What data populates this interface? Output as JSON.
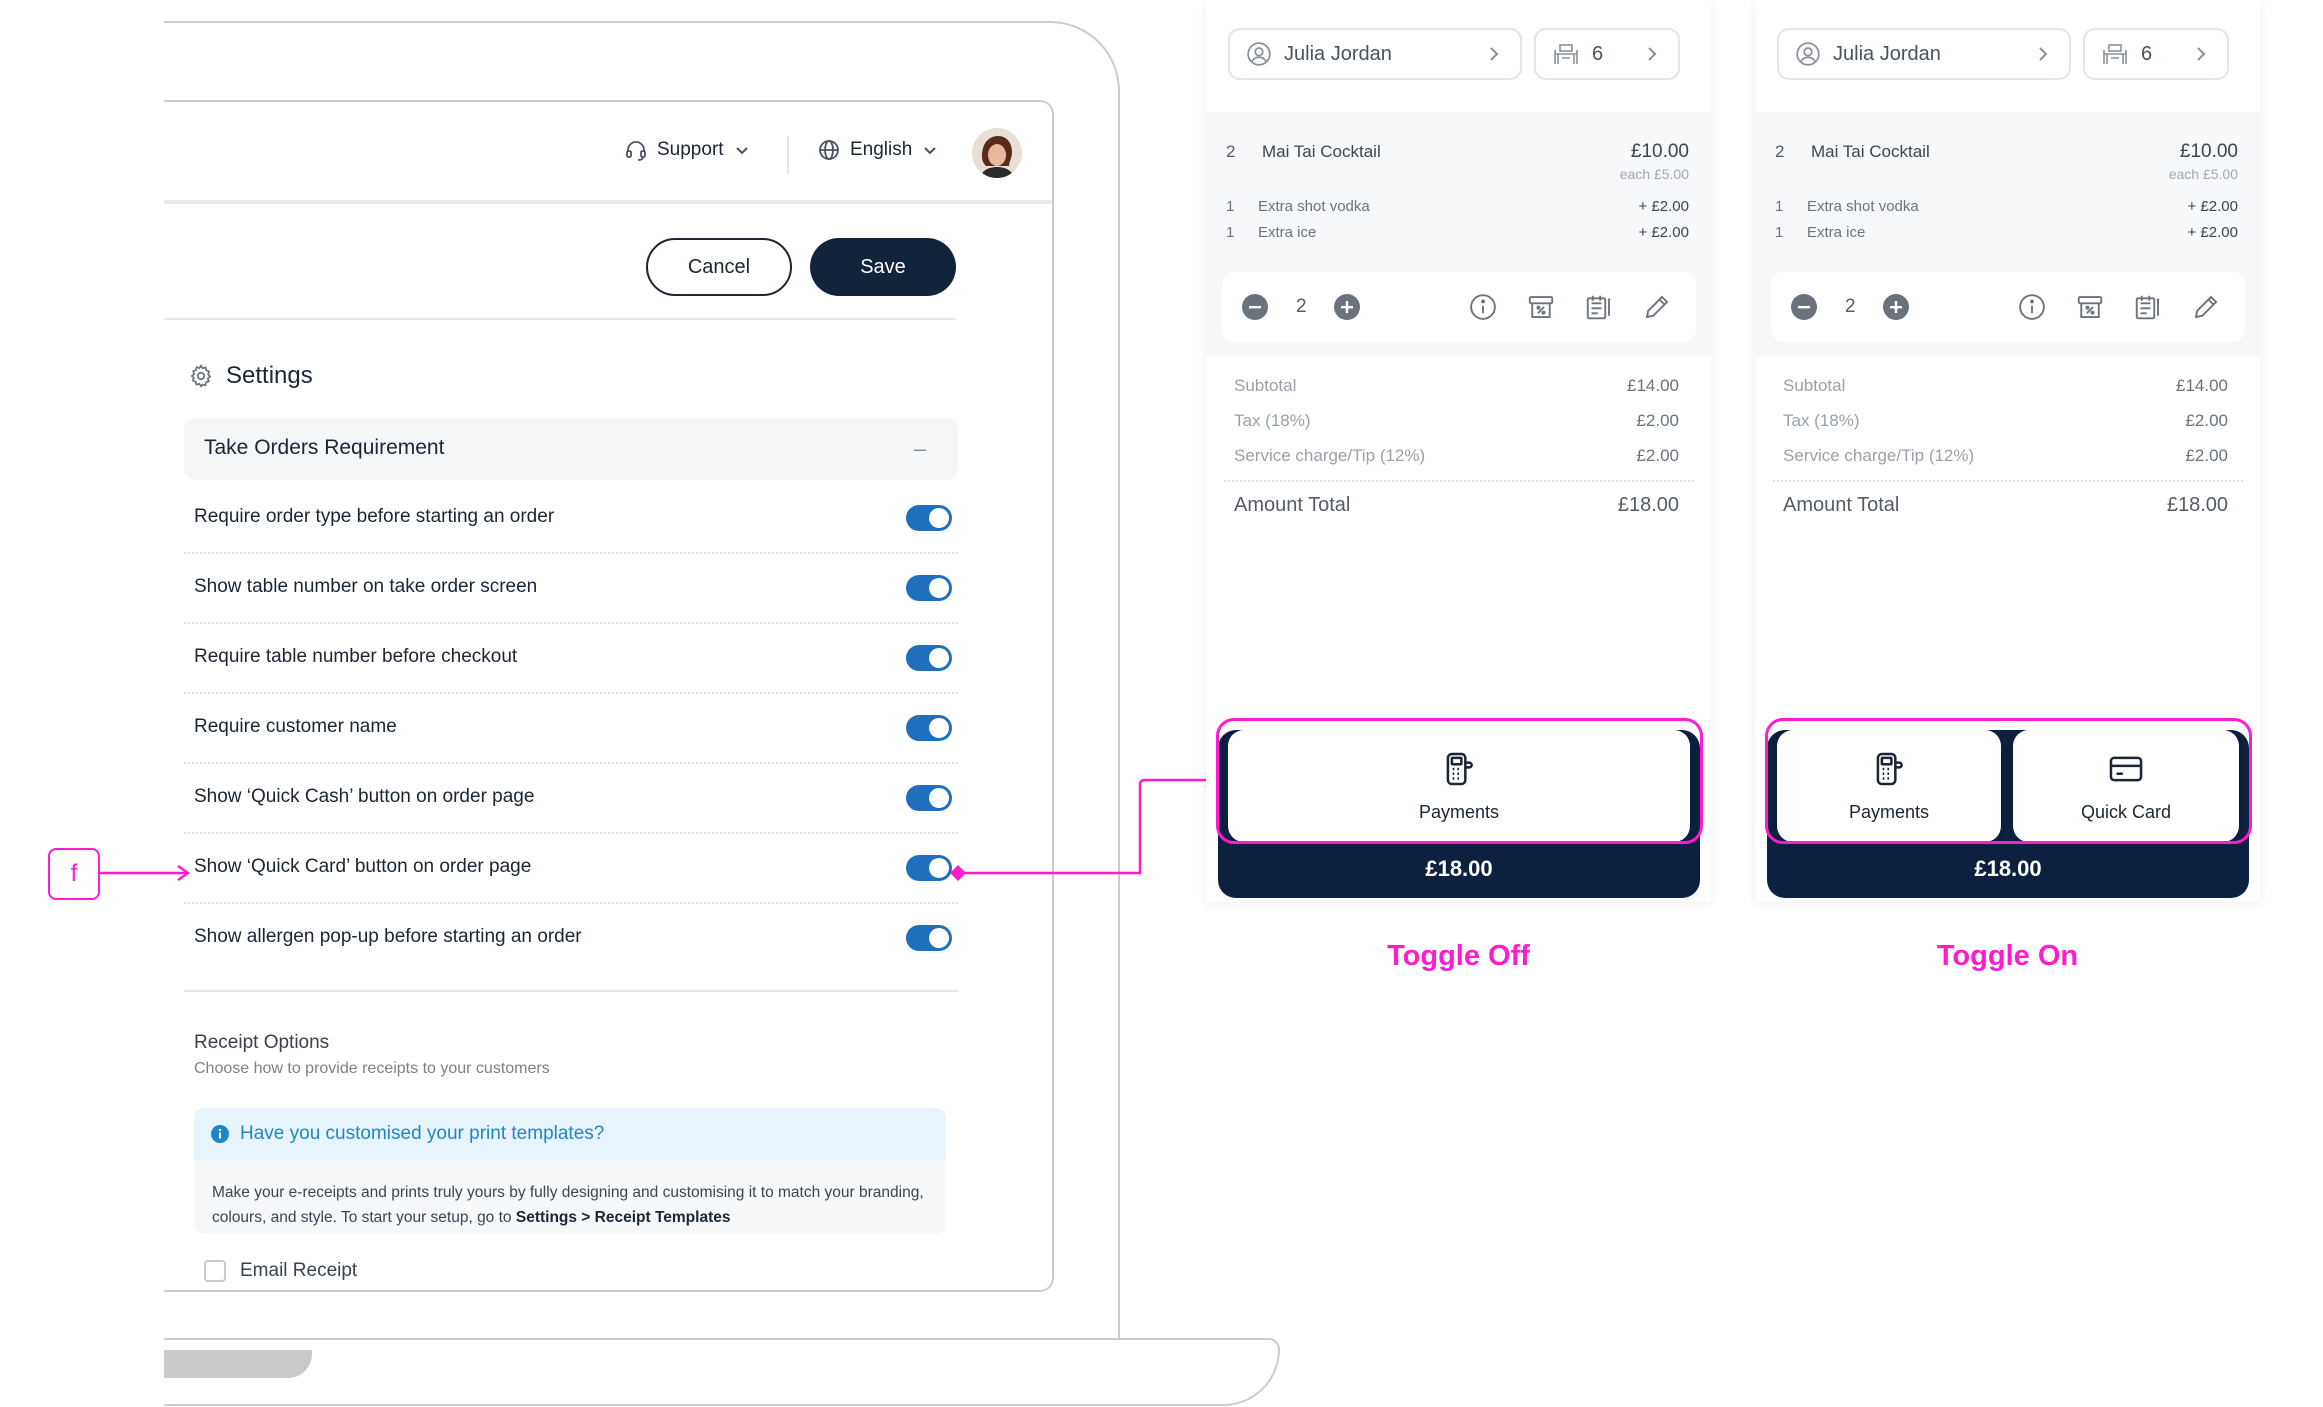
{
  "header": {
    "support_label": "Support",
    "language_label": "English"
  },
  "actions": {
    "cancel_label": "Cancel",
    "save_label": "Save"
  },
  "settings": {
    "title": "Settings",
    "section_title": "Take Orders Requirement",
    "collapse_symbol": "–",
    "options": [
      {
        "label": "Require order type before starting an order",
        "enabled": true
      },
      {
        "label": "Show table number on take order screen",
        "enabled": true
      },
      {
        "label": "Require table number before checkout",
        "enabled": true
      },
      {
        "label": "Require customer name",
        "enabled": true
      },
      {
        "label": "Show ‘Quick Cash’ button on order page",
        "enabled": true
      },
      {
        "label": "Show ‘Quick Card’ button on order page",
        "enabled": true
      },
      {
        "label": "Show allergen pop-up before starting an order",
        "enabled": true
      }
    ]
  },
  "receipt": {
    "title": "Receipt Options",
    "subtitle": "Choose how to provide receipts to your customers",
    "info_title": "Have you customised your print templates?",
    "info_body": "Make your e-receipts and prints truly yours by fully designing and customising it to match your branding, colours, and style. To start your setup, go to ",
    "info_link": "Settings > Receipt Templates",
    "email_label": "Email Receipt",
    "email_checked": false
  },
  "annotation": {
    "marker": "f",
    "color": "#ff1cd0"
  },
  "order": {
    "customer": "Julia Jordan",
    "table": "6",
    "item_qty": "2",
    "item_name": "Mai Tai Cocktail",
    "item_price": "£10.00",
    "item_each": "each £5.00",
    "modifiers": [
      {
        "qty": "1",
        "name": "Extra shot vodka",
        "price": "+ £2.00"
      },
      {
        "qty": "1",
        "name": "Extra ice",
        "price": "+ £2.00"
      }
    ],
    "stepper_value": "2",
    "subtotal_label": "Subtotal",
    "subtotal": "£14.00",
    "tax_label": "Tax (18%)",
    "tax": "£2.00",
    "service_label": "Service charge/Tip (12%)",
    "service": "£2.00",
    "total_label": "Amount Total",
    "total": "£18.00",
    "pay_amount": "£18.00",
    "payments_label": "Payments",
    "quick_card_label": "Quick Card"
  },
  "captions": {
    "off": "Toggle Off",
    "on": "Toggle On"
  },
  "colors": {
    "accent": "#ff1cd0",
    "toggle": "#1f6fbd",
    "primary": "#13233a",
    "pay_bar": "#0d2040"
  }
}
